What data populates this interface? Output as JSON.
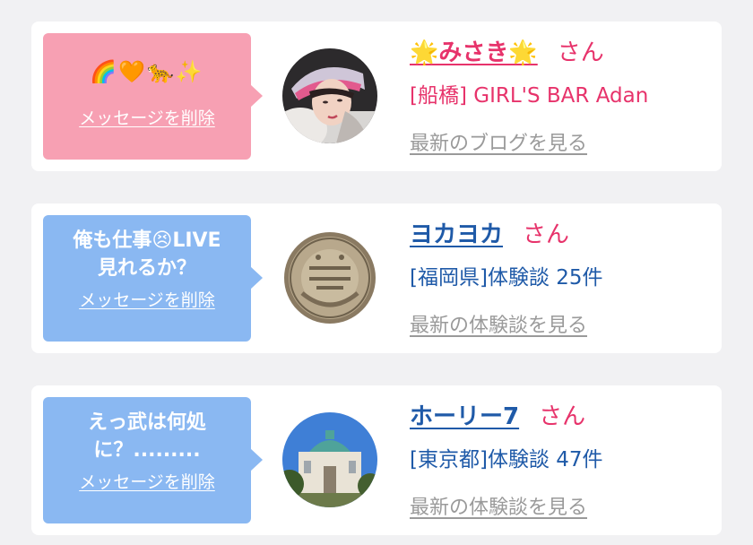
{
  "colors": {
    "pink_bubble": "#f7a0b3",
    "blue_bubble": "#8ab8f2",
    "pink_text": "#e7336b",
    "blue_text": "#1f5aa8",
    "gray_link": "#9a9a9a"
  },
  "cards": [
    {
      "bubble_message": "🌈🧡🐆✨",
      "delete_label": "メッセージを削除",
      "name": "🌟みさき🌟",
      "suffix": "さん",
      "subtitle": "[船橋] GIRL'S BAR Adan",
      "latest_link": "最新のブログを見る",
      "avatar_icon": "woman-portrait-photo"
    },
    {
      "bubble_message": "俺も仕事😣LIVE\n見れるか？",
      "delete_label": "メッセージを削除",
      "name": "ヨカヨカ",
      "suffix": "さん",
      "subtitle": "[福岡県]体験談 25件",
      "latest_link": "最新の体験談を見る",
      "avatar_icon": "gold-medal-photo"
    },
    {
      "bubble_message": "えっ武は何処\nに？.........",
      "delete_label": "メッセージを削除",
      "name": "ホーリー7",
      "suffix": "さん",
      "subtitle": "[東京都]体験談 47件",
      "latest_link": "最新の体験談を見る",
      "avatar_icon": "building-photo"
    }
  ]
}
